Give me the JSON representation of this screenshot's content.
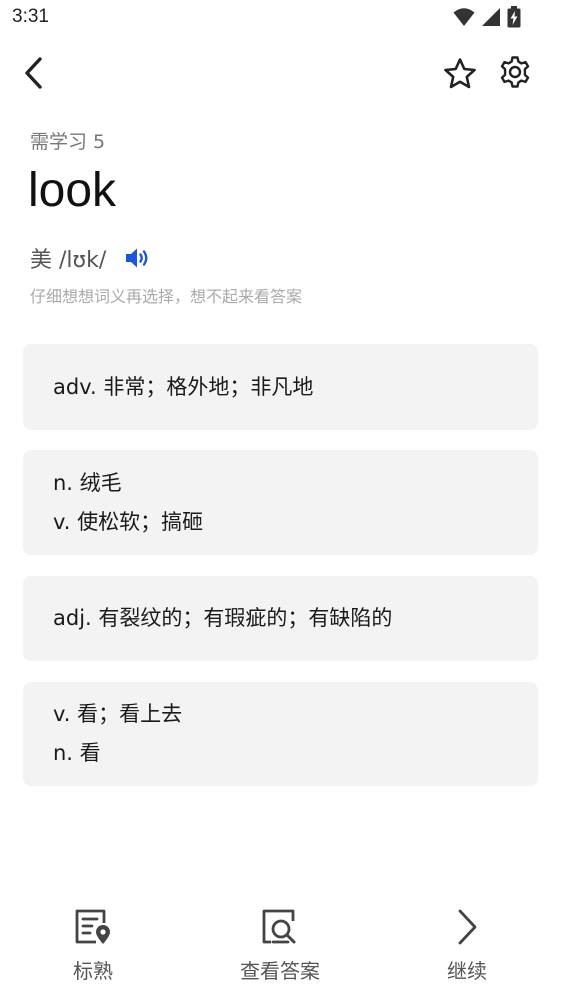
{
  "status_bar": {
    "time": "3:31"
  },
  "header": {
    "need_study": "需学习 5",
    "word": "look",
    "phonetic": "美 /lʊk/",
    "hint": "仔细想想词义再选择，想不起来看答案"
  },
  "options": [
    {
      "lines": [
        "adv. 非常；格外地；非凡地"
      ]
    },
    {
      "lines": [
        "n. 绒毛",
        "v. 使松软；搞砸"
      ]
    },
    {
      "lines": [
        "adj. 有裂纹的；有瑕疵的；有缺陷的"
      ]
    },
    {
      "lines": [
        "v. 看；看上去",
        "n. 看"
      ]
    }
  ],
  "bottom_bar": {
    "familiar_label": "标熟",
    "answer_label": "查看答案",
    "continue_label": "继续"
  },
  "colors": {
    "speaker_accent": "#1a56d6",
    "card_bg": "#f3f3f3"
  },
  "icons": {
    "back": "chevron-left-icon",
    "favorite": "star-icon",
    "settings": "gear-icon",
    "pronounce": "speaker-icon",
    "familiar": "document-pin-icon",
    "answer": "document-search-icon",
    "continue": "chevron-right-icon"
  }
}
